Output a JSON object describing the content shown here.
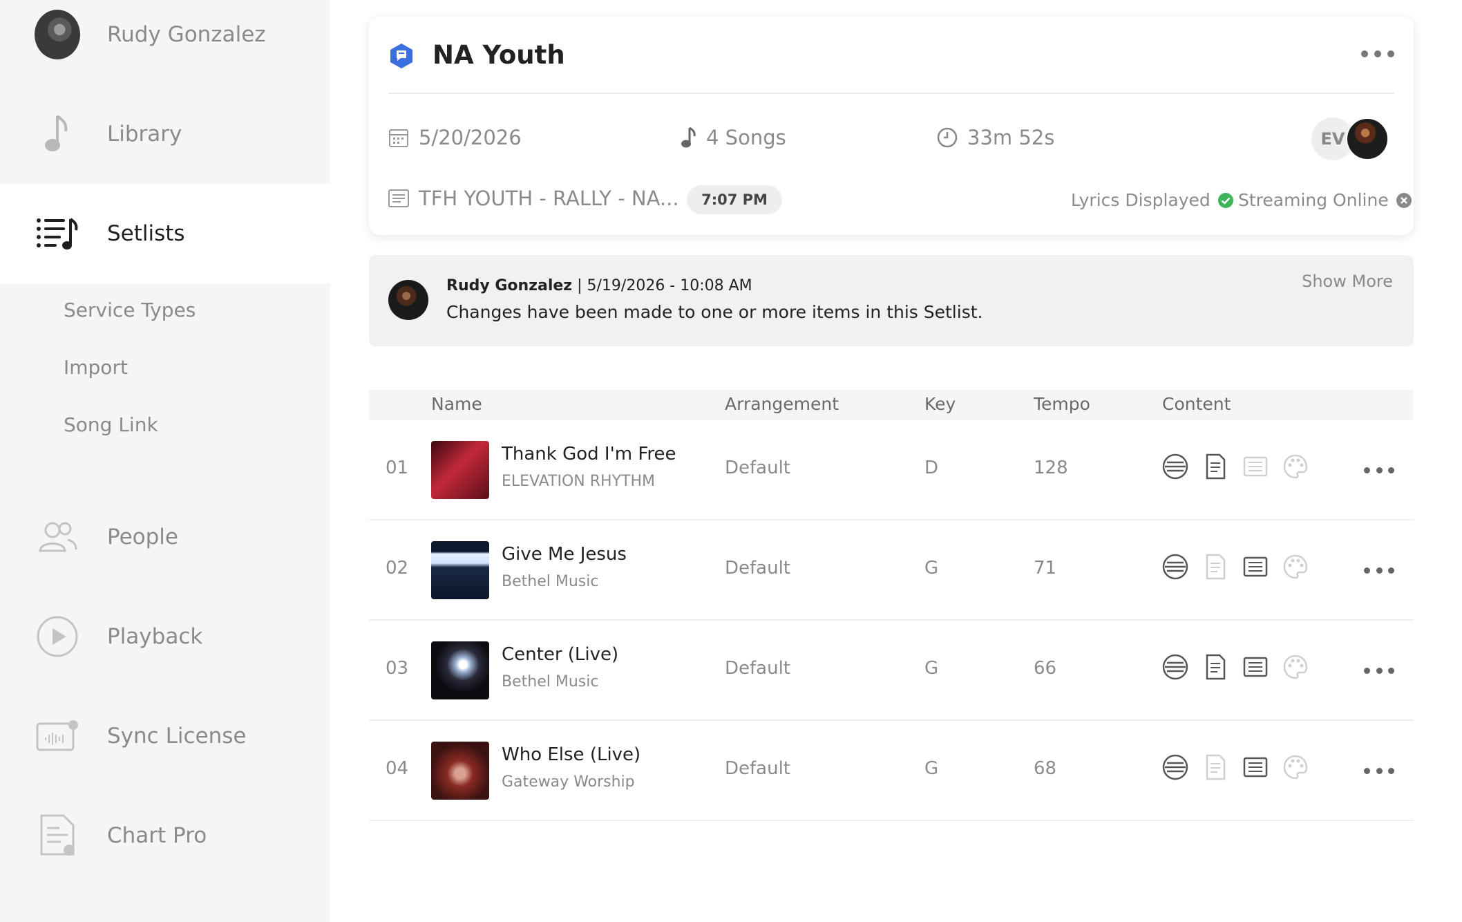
{
  "sidebar": {
    "user_name": "Rudy Gonzalez",
    "nav": [
      {
        "label": "Library",
        "icon": "music-note-icon"
      },
      {
        "label": "Setlists",
        "icon": "setlist-icon",
        "active": true
      },
      {
        "label": "People",
        "icon": "people-icon"
      },
      {
        "label": "Playback",
        "icon": "play-icon"
      },
      {
        "label": "Sync License",
        "icon": "sync-license-icon"
      },
      {
        "label": "Chart Pro",
        "icon": "chart-pro-icon"
      }
    ],
    "subitems": [
      "Service Types",
      "Import",
      "Song Link"
    ]
  },
  "setlist": {
    "title": "NA Youth",
    "date": "5/20/2026",
    "songs": "4 Songs",
    "duration": "33m 52s",
    "service": "TFH YOUTH - RALLY - NA...",
    "time": "7:07 PM",
    "lyrics_status": "Lyrics Displayed",
    "streaming_status": "Streaming Online",
    "team_initials": "EV"
  },
  "activity": {
    "author": "Rudy Gonzalez",
    "timestamp": " | 5/19/2026 - 10:08 AM",
    "message": "Changes have been made to one or more items in this Setlist.",
    "show_more": "Show More"
  },
  "table": {
    "headers": {
      "name": "Name",
      "arrangement": "Arrangement",
      "key": "Key",
      "tempo": "Tempo",
      "content": "Content"
    },
    "rows": [
      {
        "num": "01",
        "title": "Thank God I'm Free",
        "artist": "ELEVATION RHYTHM",
        "arrangement": "Default",
        "key": "D",
        "tempo": "128"
      },
      {
        "num": "02",
        "title": "Give Me Jesus",
        "artist": "Bethel Music",
        "arrangement": "Default",
        "key": "G",
        "tempo": "71"
      },
      {
        "num": "03",
        "title": "Center (Live)",
        "artist": "Bethel Music",
        "arrangement": "Default",
        "key": "G",
        "tempo": "66"
      },
      {
        "num": "04",
        "title": "Who Else (Live)",
        "artist": "Gateway Worship",
        "arrangement": "Default",
        "key": "G",
        "tempo": "68"
      }
    ]
  },
  "colors": {
    "accent": "#3b6fe0",
    "success": "#3cb55a",
    "inactive": "#8a8a8a"
  }
}
